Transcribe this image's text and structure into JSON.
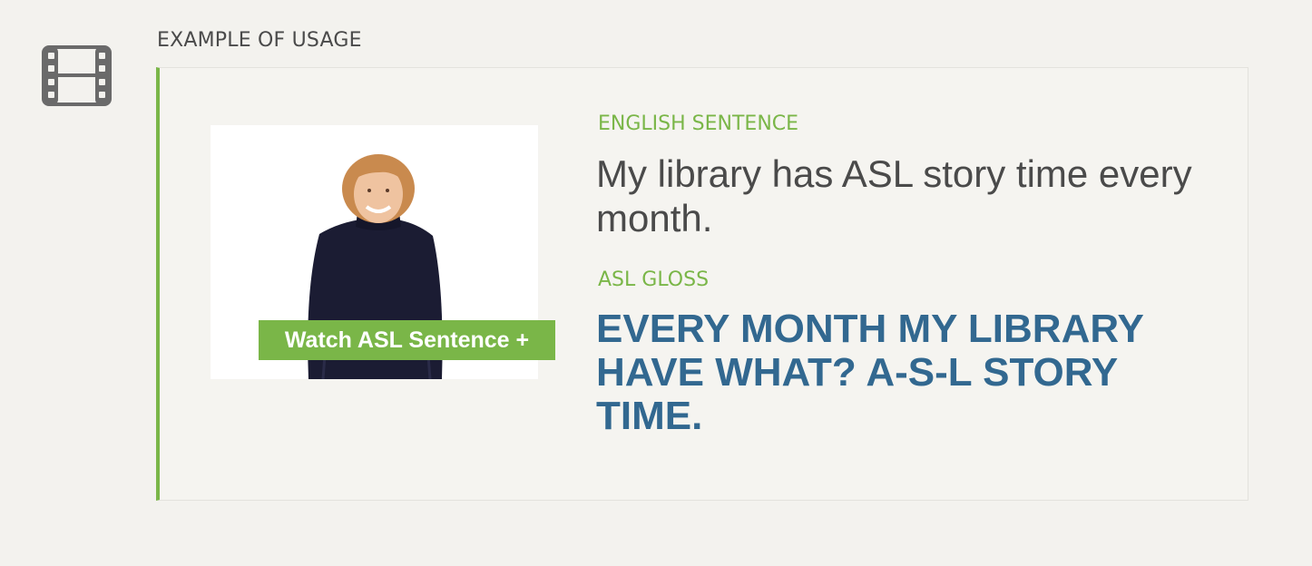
{
  "section": {
    "icon": "film-icon",
    "label": "EXAMPLE OF USAGE"
  },
  "video": {
    "button_label": "Watch ASL Sentence +",
    "button_color": "#7ab648"
  },
  "english": {
    "label": "ENGLISH SENTENCE",
    "sentence": "My library has ASL story time every month."
  },
  "gloss": {
    "label": "ASL GLOSS",
    "text": "EVERY MONTH MY LIBRARY HAVE WHAT? A-S-L STORY TIME."
  },
  "colors": {
    "accent_green": "#7ab648",
    "gloss_blue": "#326890",
    "text_gray": "#4a4a4a"
  }
}
